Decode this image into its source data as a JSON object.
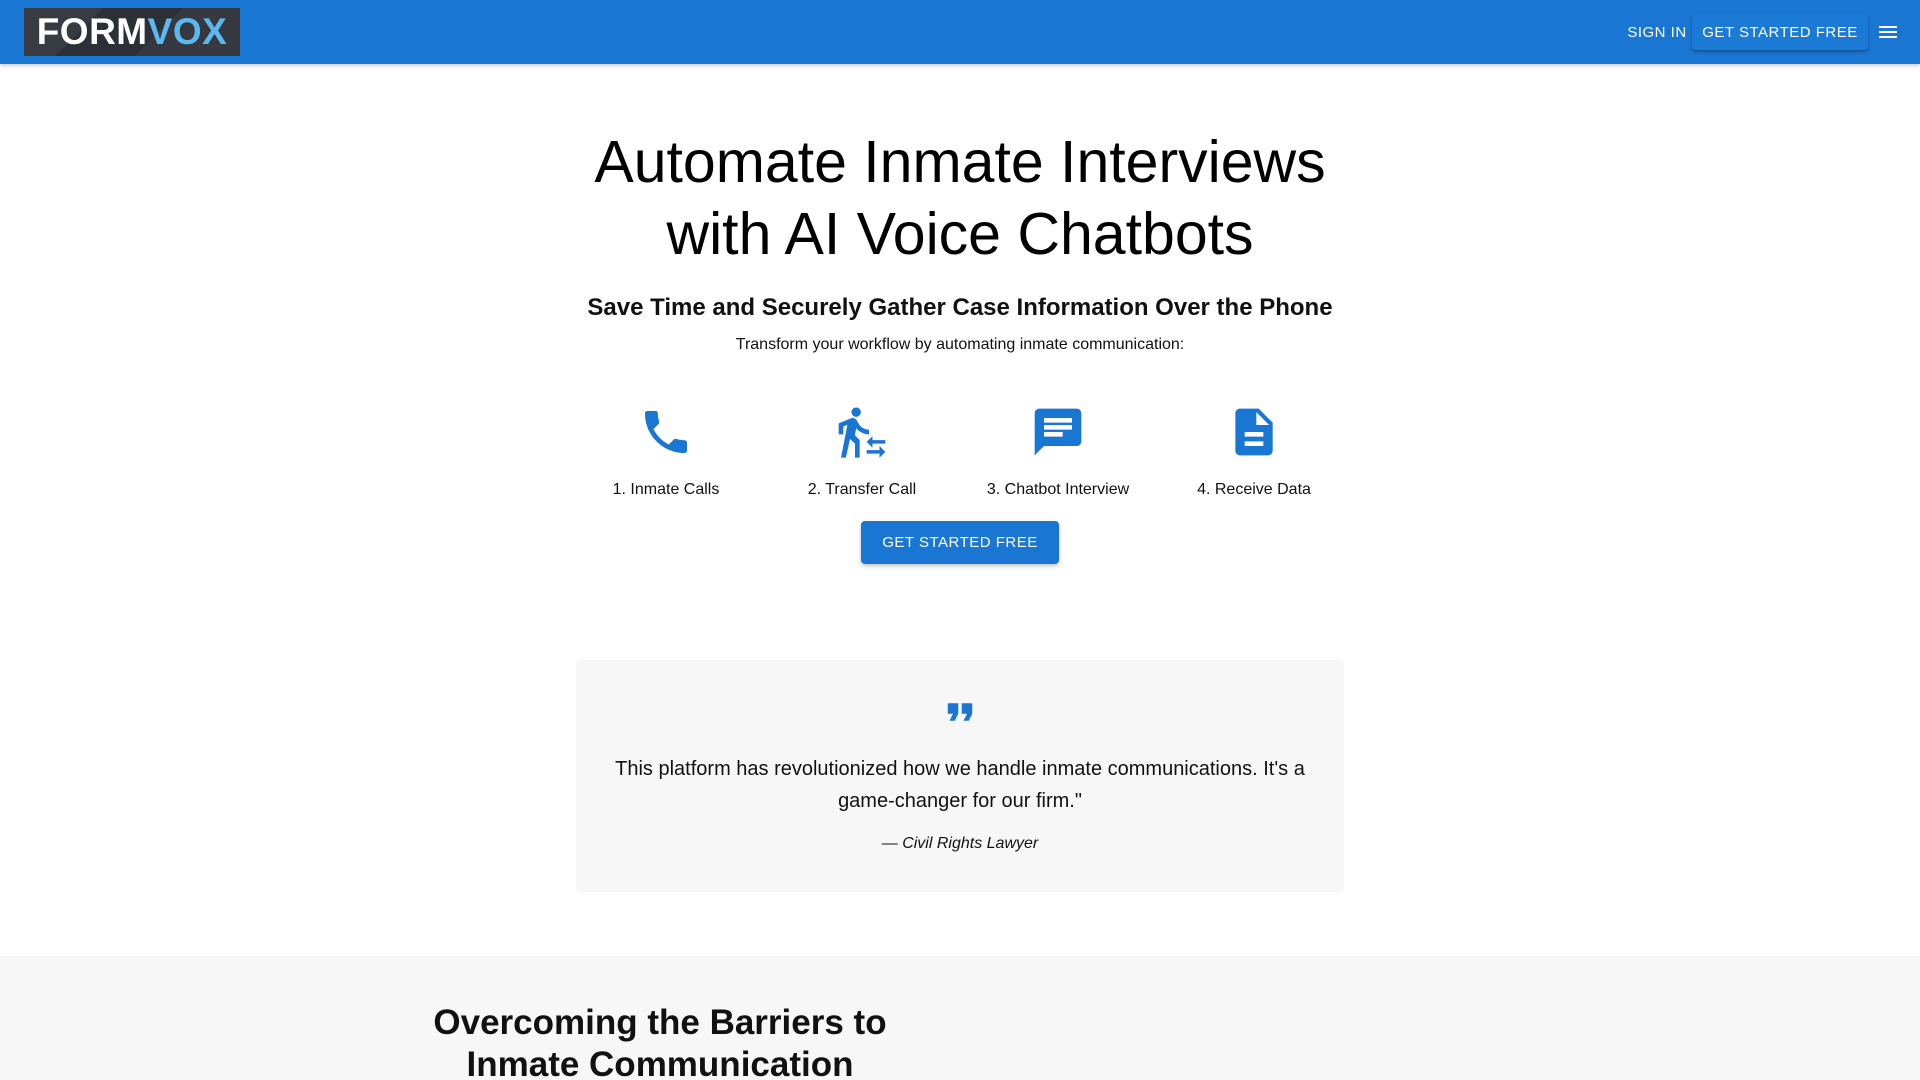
{
  "header": {
    "logo": {
      "part1": "FORM",
      "part2": "VOX"
    },
    "nav": {
      "signin_label": "SIGN IN",
      "cta_label": "GET STARTED FREE",
      "menu_icon": "menu-icon"
    }
  },
  "hero": {
    "title": "Automate Inmate Interviews with AI Voice Chatbots",
    "subtitle": "Save Time and Securely Gather Case Information Over the Phone",
    "text": "Transform your workflow by automating inmate communication:",
    "steps": [
      {
        "icon": "phone-icon",
        "label": "1. Inmate Calls"
      },
      {
        "icon": "transfer-within-station-icon",
        "label": "2. Transfer Call"
      },
      {
        "icon": "chat-icon",
        "label": "3. Chatbot Interview"
      },
      {
        "icon": "document-icon",
        "label": "4. Receive Data"
      }
    ],
    "cta_label": "GET STARTED FREE"
  },
  "testimonial": {
    "icon": "format-quote-icon",
    "quote": "This platform has revolutionized how we handle inmate communications. It's a game-changer for our firm.\"",
    "author": "— Civil Rights Lawyer"
  },
  "section": {
    "title": "Overcoming the Barriers to Inmate Communication"
  },
  "colors": {
    "primary": "#1976d2",
    "logo_bg": "#2b2f36",
    "logo_accent": "#5bb8f0",
    "card_bg": "#f7f7f7"
  }
}
